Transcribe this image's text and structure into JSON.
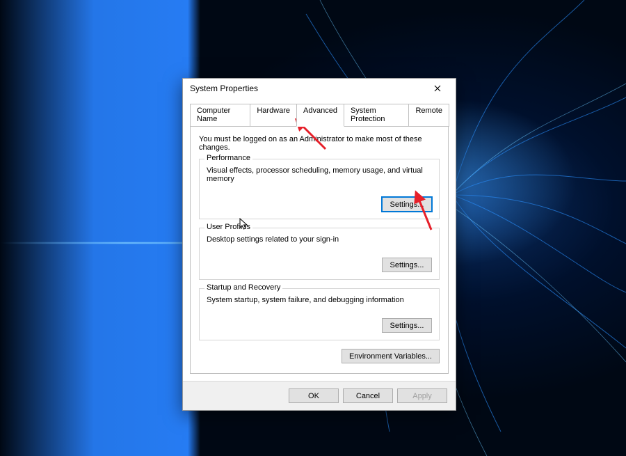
{
  "dialog": {
    "title": "System Properties",
    "tabs": [
      {
        "label": "Computer Name"
      },
      {
        "label": "Hardware"
      },
      {
        "label": "Advanced"
      },
      {
        "label": "System Protection"
      },
      {
        "label": "Remote"
      }
    ],
    "active_tab_index": 2,
    "notice": "You must be logged on as an Administrator to make most of these changes.",
    "groups": {
      "performance": {
        "title": "Performance",
        "desc": "Visual effects, processor scheduling, memory usage, and virtual memory",
        "button": "Settings..."
      },
      "user_profiles": {
        "title": "User Profiles",
        "desc": "Desktop settings related to your sign-in",
        "button": "Settings..."
      },
      "startup": {
        "title": "Startup and Recovery",
        "desc": "System startup, system failure, and debugging information",
        "button": "Settings..."
      }
    },
    "env_button": "Environment Variables...",
    "buttons": {
      "ok": "OK",
      "cancel": "Cancel",
      "apply": "Apply"
    }
  }
}
